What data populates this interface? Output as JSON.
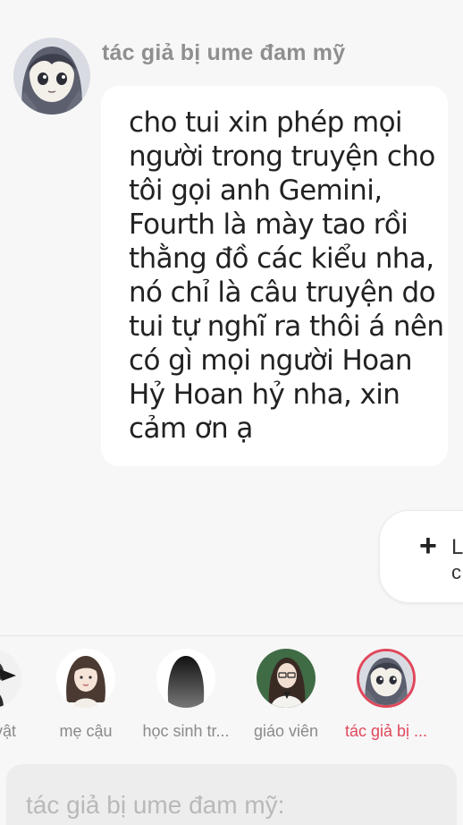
{
  "message": {
    "author": "tác giả bị ume đam mỹ",
    "avatar_icon": "anime-girl-avatar",
    "lines": [
      "cho tui xin phép mọi",
      "người trong truyện cho",
      "tôi gọi anh Gemini,",
      "Fourth là mày tao rồi",
      "thằng đồ các kiểu nha,",
      "nó chỉ là câu truyện do",
      "tui tự nghĩ ra thôi á nên",
      "có gì mọi người Hoan",
      "Hỷ Hoan hỷ nha, xin",
      "cảm ơn ạ"
    ]
  },
  "float_button": {
    "icon": "plus-icon",
    "label_line1": "L",
    "label_line2": "c"
  },
  "characters": [
    {
      "name": "vật",
      "icon": "character-avatar"
    },
    {
      "name": "mẹ cậu",
      "icon": "woman-avatar"
    },
    {
      "name": "học sinh tr...",
      "icon": "silhouette-avatar"
    },
    {
      "name": "giáo viên",
      "icon": "teacher-avatar"
    },
    {
      "name": "tác giả bị ...",
      "icon": "anime-girl-avatar",
      "active": true
    }
  ],
  "composer": {
    "placeholder": "tác giả bị ume đam mỹ:"
  },
  "colors": {
    "background": "#f7f7f7",
    "bubble": "#ffffff",
    "active": "#e0485c",
    "muted_text": "#8f8f8f"
  }
}
